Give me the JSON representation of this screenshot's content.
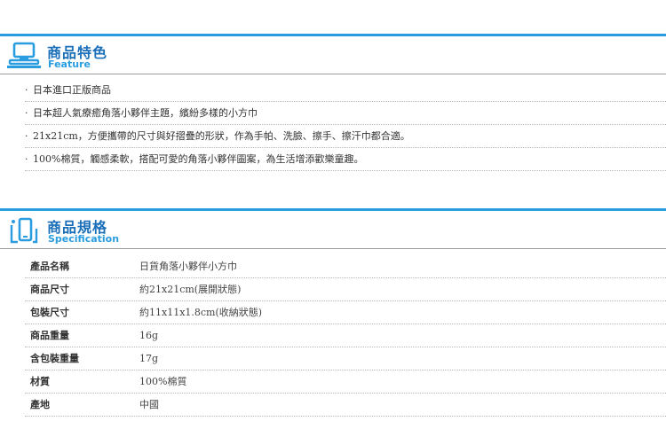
{
  "feature": {
    "title": "商品特色",
    "subtitle": "Feature",
    "icon": "monitor-icon",
    "items": [
      "日本進口正版商品",
      "日本超人氣療癒角落小夥伴主題，繽紛多樣的小方巾",
      "21x21cm，方便攜帶的尺寸與好摺疊的形狀，作為手帕、洗臉、擦手、擦汗巾都合適。",
      "100%棉質，觸感柔軟，搭配可愛的角落小夥伴圖案，為生活增添歡樂童趣。"
    ]
  },
  "spec": {
    "title": "商品規格",
    "subtitle": "Specification",
    "icon": "mobile-icon",
    "rows": [
      {
        "label": "產品名稱",
        "value": "日貨角落小夥伴小方巾"
      },
      {
        "label": "商品尺寸",
        "value": "約21x21cm(展開狀態)"
      },
      {
        "label": "包裝尺寸",
        "value": "約11x11x1.8cm(收納狀態)"
      },
      {
        "label": "商品重量",
        "value": "16g"
      },
      {
        "label": "含包裝重量",
        "value": "17g"
      },
      {
        "label": "材質",
        "value": "100%棉質"
      },
      {
        "label": "產地",
        "value": "中國"
      }
    ]
  },
  "colors": {
    "accent": "#2a9de0",
    "title": "#1a6fb8",
    "divider": "#9a9a9a"
  }
}
